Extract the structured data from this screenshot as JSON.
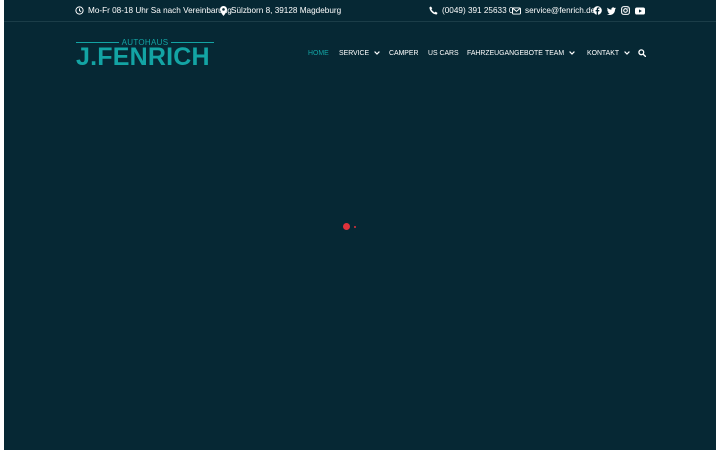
{
  "topbar": {
    "hours": "Mo-Fr 08-18 Uhr Sa nach Vereinbarung",
    "address": "Sülzborn 8, 39128 Magdeburg",
    "phone": "(0049) 391 25633 0",
    "email": "service@fenrich.de",
    "social_icons": [
      "facebook-icon",
      "twitter-icon",
      "instagram-icon",
      "youtube-icon"
    ]
  },
  "logo": {
    "subtitle": "AUTOHAUS",
    "name": "J.FENRICH"
  },
  "nav": {
    "items": [
      {
        "label": "HOME",
        "active": true,
        "has_dropdown": false
      },
      {
        "label": "SERVICE",
        "active": false,
        "has_dropdown": true
      },
      {
        "label": "CAMPER",
        "active": false,
        "has_dropdown": false
      },
      {
        "label": "US CARS",
        "active": false,
        "has_dropdown": false
      },
      {
        "label": "FAHRZEUGANGEBOTE",
        "active": false,
        "has_dropdown": false
      },
      {
        "label": "TEAM",
        "active": false,
        "has_dropdown": true
      },
      {
        "label": "KONTAKT",
        "active": false,
        "has_dropdown": true
      }
    ],
    "search_icon": "search-icon"
  },
  "colors": {
    "background": "#062834",
    "accent": "#13a4a4",
    "loader": "#e0323b",
    "text": "#ffffff"
  }
}
